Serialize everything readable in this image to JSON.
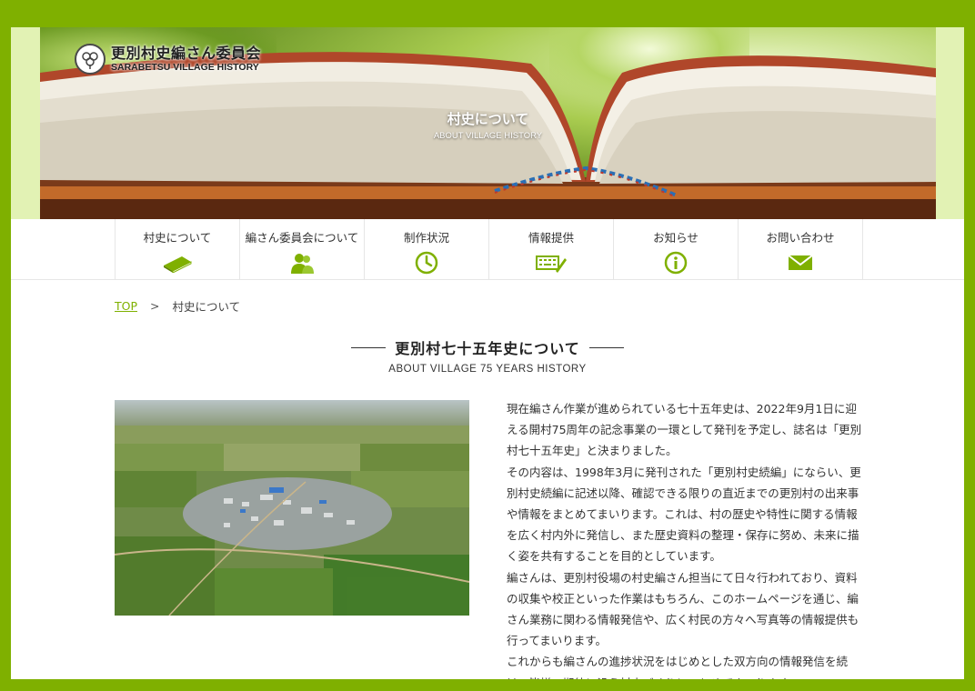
{
  "header": {
    "logo_ja": "更別村史編さん委員会",
    "logo_en": "SARABETSU VILLAGE HISTORY",
    "hero_title_ja": "村史について",
    "hero_title_en": "ABOUT VILLAGE HISTORY"
  },
  "nav": {
    "items": [
      {
        "label": "村史について",
        "icon": "book-icon"
      },
      {
        "label": "編さん委員会について",
        "icon": "people-icon"
      },
      {
        "label": "制作状況",
        "icon": "clock-icon"
      },
      {
        "label": "情報提供",
        "icon": "keyboard-icon"
      },
      {
        "label": "お知らせ",
        "icon": "info-icon"
      },
      {
        "label": "お問い合わせ",
        "icon": "mail-icon"
      }
    ]
  },
  "breadcrumb": {
    "top": "TOP",
    "separator": ">",
    "current": "村史について"
  },
  "section": {
    "title_ja": "更別村七十五年史について",
    "title_en": "ABOUT VILLAGE 75 YEARS HISTORY"
  },
  "body": {
    "paragraphs": [
      "現在編さん作業が進められている七十五年史は、2022年9月1日に迎える開村75周年の記念事業の一環として発刊を予定し、誌名は「更別村七十五年史」と決まりました。",
      "その内容は、1998年3月に発刊された「更別村史続編」にならい、更別村史続編に記述以降、確認できる限りの直近までの更別村の出来事や情報をまとめてまいります。これは、村の歴史や特性に関する情報を広く村内外に発信し、また歴史資料の整理・保存に努め、未来に描く姿を共有することを目的としています。",
      "編さんは、更別村役場の村史編さん担当にて日々行われており、資料の収集や校正といった作業はもちろん、このホームページを通じ、編さん業務に関わる情報発信や、広く村民の方々へ写真等の情報提供も行ってまいります。",
      "これからも編さんの進捗状況をはじめとした双方向の情報発信を続け、皆様の期待に沿う村史づくりにつとめてまいりますので"
    ]
  },
  "colors": {
    "accent": "#7fb000",
    "hero_band": "#e2f2b4",
    "text": "#333333"
  }
}
